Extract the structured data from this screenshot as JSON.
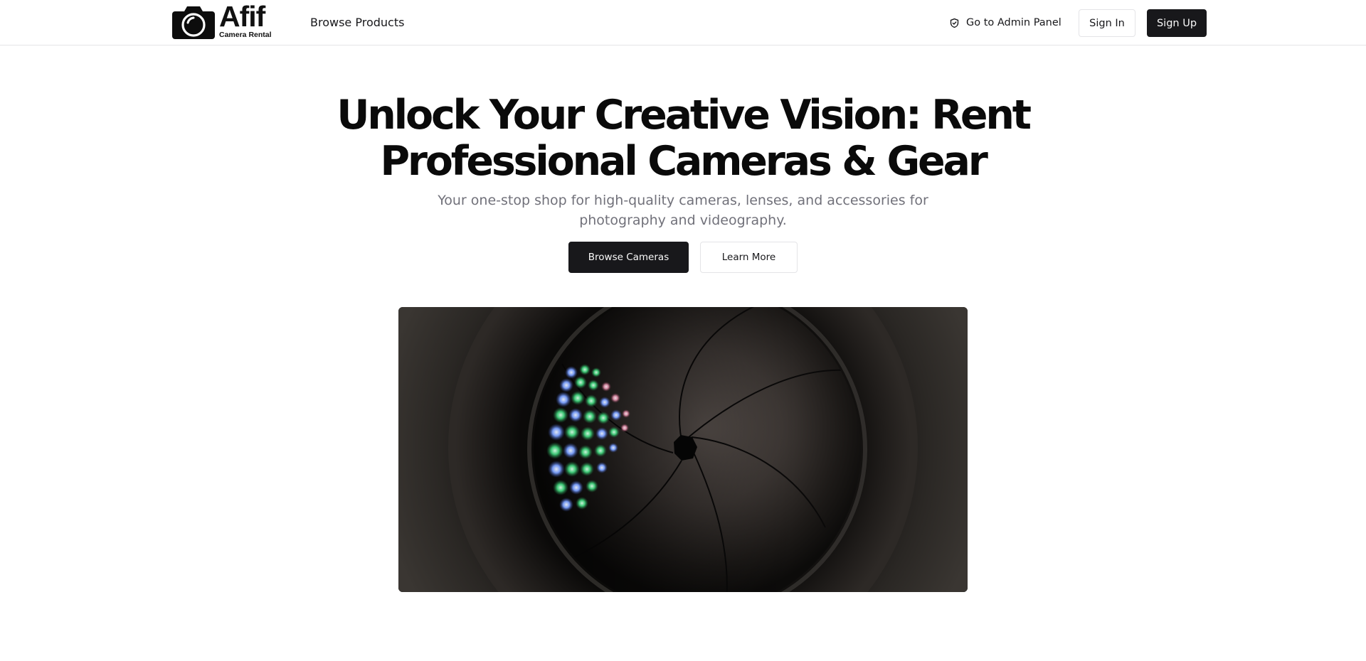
{
  "brand": {
    "name": "Afif",
    "tagline": "Camera Rental",
    "logo_icon": "camera-icon"
  },
  "nav": {
    "browse_products": "Browse Products",
    "admin_panel": "Go to Admin Panel",
    "admin_icon": "shield-icon",
    "sign_in": "Sign In",
    "sign_up": "Sign Up"
  },
  "hero": {
    "title": "Unlock Your Creative Vision: Rent Professional Cameras & Gear",
    "subtitle": "Your one-stop shop for high-quality cameras, lenses, and accessories for photography and videography.",
    "primary_cta": "Browse Cameras",
    "secondary_cta": "Learn More"
  },
  "colors": {
    "primary": "#18181b",
    "muted_text": "#71717a",
    "border": "#e4e4e7",
    "background": "#ffffff"
  }
}
